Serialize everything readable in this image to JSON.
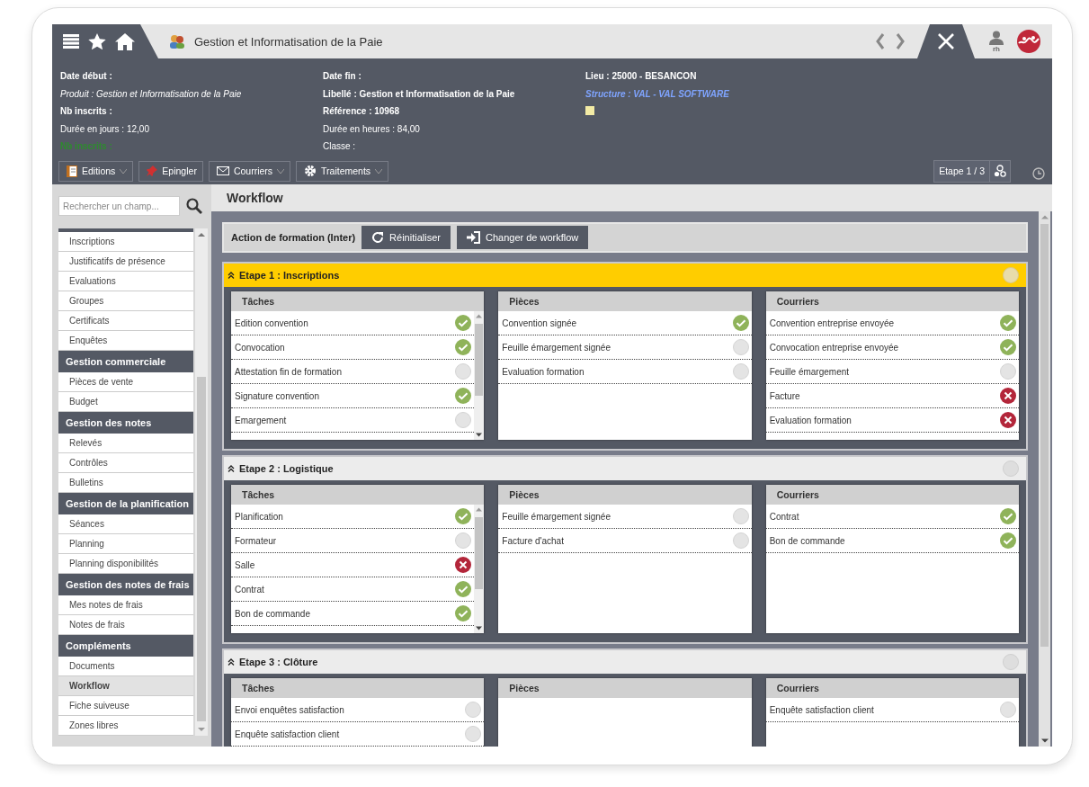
{
  "header": {
    "title": "Gestion et Informatisation de la Paie",
    "user": "rh"
  },
  "info": {
    "columns": [
      [
        {
          "text": "Date début :",
          "kind": "strong"
        },
        {
          "text": "Produit : Gestion et Informatisation de la Paie",
          "kind": "note"
        },
        {
          "text": "Nb inscrits :",
          "kind": "strong"
        },
        {
          "text": "Durée en jours : 12,00",
          "kind": "plain"
        },
        {
          "text": "Nb inscrits :",
          "kind": "highlight"
        }
      ],
      [
        {
          "text": "Date fin :",
          "kind": "strong"
        },
        {
          "text": "Libellé : Gestion et Informatisation de la Paie",
          "kind": "strong"
        },
        {
          "text": "Référence : 10968",
          "kind": "strong"
        },
        {
          "text": "Durée en heures : 84,00",
          "kind": "plain"
        },
        {
          "text": "Classe :",
          "kind": "plain"
        }
      ],
      [
        {
          "text": "Lieu : 25000 - BESANCON",
          "kind": "strong"
        },
        {
          "text": "Structure : VAL - VAL SOFTWARE",
          "kind": "link"
        },
        {
          "kind": "swatch"
        }
      ]
    ]
  },
  "toolbar": {
    "buttons": [
      {
        "label": "Editions",
        "dropdown": true
      },
      {
        "label": "Epingler",
        "dropdown": false
      },
      {
        "label": "Courriers",
        "dropdown": true
      },
      {
        "label": "Traitements",
        "dropdown": true
      }
    ],
    "step_indicator": "Etape 1 / 3"
  },
  "sidebar": {
    "search_placeholder": "Rechercher un champ...",
    "items": [
      {
        "kind": "item",
        "label": "Inscriptions",
        "selected": false
      },
      {
        "kind": "item",
        "label": "Justificatifs de présence",
        "selected": false
      },
      {
        "kind": "item",
        "label": "Evaluations",
        "selected": false
      },
      {
        "kind": "item",
        "label": "Groupes",
        "selected": false
      },
      {
        "kind": "item",
        "label": "Certificats",
        "selected": false
      },
      {
        "kind": "item",
        "label": "Enquêtes",
        "selected": false
      },
      {
        "kind": "header",
        "label": "Gestion commerciale"
      },
      {
        "kind": "item",
        "label": "Pièces de vente",
        "selected": false
      },
      {
        "kind": "item",
        "label": "Budget",
        "selected": false
      },
      {
        "kind": "header",
        "label": "Gestion des notes"
      },
      {
        "kind": "item",
        "label": "Relevés",
        "selected": false
      },
      {
        "kind": "item",
        "label": "Contrôles",
        "selected": false
      },
      {
        "kind": "item",
        "label": "Bulletins",
        "selected": false
      },
      {
        "kind": "header",
        "label": "Gestion de la planification"
      },
      {
        "kind": "item",
        "label": "Séances",
        "selected": false
      },
      {
        "kind": "item",
        "label": "Planning",
        "selected": false
      },
      {
        "kind": "item",
        "label": "Planning disponibilités",
        "selected": false
      },
      {
        "kind": "header",
        "label": "Gestion des notes de frais"
      },
      {
        "kind": "item",
        "label": "Mes notes de frais",
        "selected": false
      },
      {
        "kind": "item",
        "label": "Notes de frais",
        "selected": false
      },
      {
        "kind": "header",
        "label": "Compléments"
      },
      {
        "kind": "item",
        "label": "Documents",
        "selected": false
      },
      {
        "kind": "item",
        "label": "Workflow",
        "selected": true
      },
      {
        "kind": "item",
        "label": "Fiche suiveuse",
        "selected": false
      },
      {
        "kind": "item",
        "label": "Zones libres",
        "selected": false
      }
    ]
  },
  "main": {
    "title": "Workflow",
    "action_label": "Action de formation (Inter)",
    "actions": [
      {
        "label": "Réinitialiser"
      },
      {
        "label": "Changer de workflow"
      }
    ],
    "steps": [
      {
        "title": "Etape 1 : Inscriptions",
        "active": true,
        "columns": [
          {
            "title": "Tâches",
            "scrollable": true,
            "items": [
              {
                "label": "Edition convention",
                "kind": "done"
              },
              {
                "label": "Convocation",
                "kind": "done"
              },
              {
                "label": "Attestation fin de formation",
                "kind": "todo"
              },
              {
                "label": "Signature convention",
                "kind": "done"
              },
              {
                "label": "Emargement",
                "kind": "todo"
              }
            ]
          },
          {
            "title": "Pièces",
            "scrollable": false,
            "items": [
              {
                "label": "Convention signée",
                "kind": "done"
              },
              {
                "label": "Feuille émargement signée",
                "kind": "todo"
              },
              {
                "label": "Evaluation formation",
                "kind": "todo"
              }
            ]
          },
          {
            "title": "Courriers",
            "scrollable": false,
            "items": [
              {
                "label": "Convention entreprise envoyée",
                "kind": "done"
              },
              {
                "label": "Convocation entreprise envoyée",
                "kind": "done"
              },
              {
                "label": "Feuille émargement",
                "kind": "todo"
              },
              {
                "label": "Facture",
                "kind": "error"
              },
              {
                "label": "Evaluation formation",
                "kind": "error"
              }
            ]
          }
        ]
      },
      {
        "title": "Etape 2 : Logistique",
        "active": false,
        "columns": [
          {
            "title": "Tâches",
            "scrollable": true,
            "items": [
              {
                "label": "Planification",
                "kind": "done"
              },
              {
                "label": "Formateur",
                "kind": "todo"
              },
              {
                "label": "Salle",
                "kind": "error"
              },
              {
                "label": "Contrat",
                "kind": "done"
              },
              {
                "label": "Bon de commande",
                "kind": "done"
              }
            ]
          },
          {
            "title": "Pièces",
            "scrollable": false,
            "items": [
              {
                "label": "Feuille émargement signée",
                "kind": "todo"
              },
              {
                "label": "Facture d'achat",
                "kind": "todo"
              }
            ]
          },
          {
            "title": "Courriers",
            "scrollable": false,
            "items": [
              {
                "label": "Contrat",
                "kind": "done"
              },
              {
                "label": "Bon de commande",
                "kind": "done"
              }
            ]
          }
        ]
      },
      {
        "title": "Etape 3 : Clôture",
        "active": false,
        "columns": [
          {
            "title": "Tâches",
            "scrollable": false,
            "items": [
              {
                "label": "Envoi enquêtes satisfaction",
                "kind": "todo"
              },
              {
                "label": "Enquête satisfaction client",
                "kind": "todo"
              }
            ]
          },
          {
            "title": "Pièces",
            "scrollable": false
          },
          {
            "title": "Courriers",
            "scrollable": false,
            "items": [
              {
                "label": "Enquête satisfaction client",
                "kind": "todo"
              }
            ]
          }
        ]
      }
    ]
  }
}
